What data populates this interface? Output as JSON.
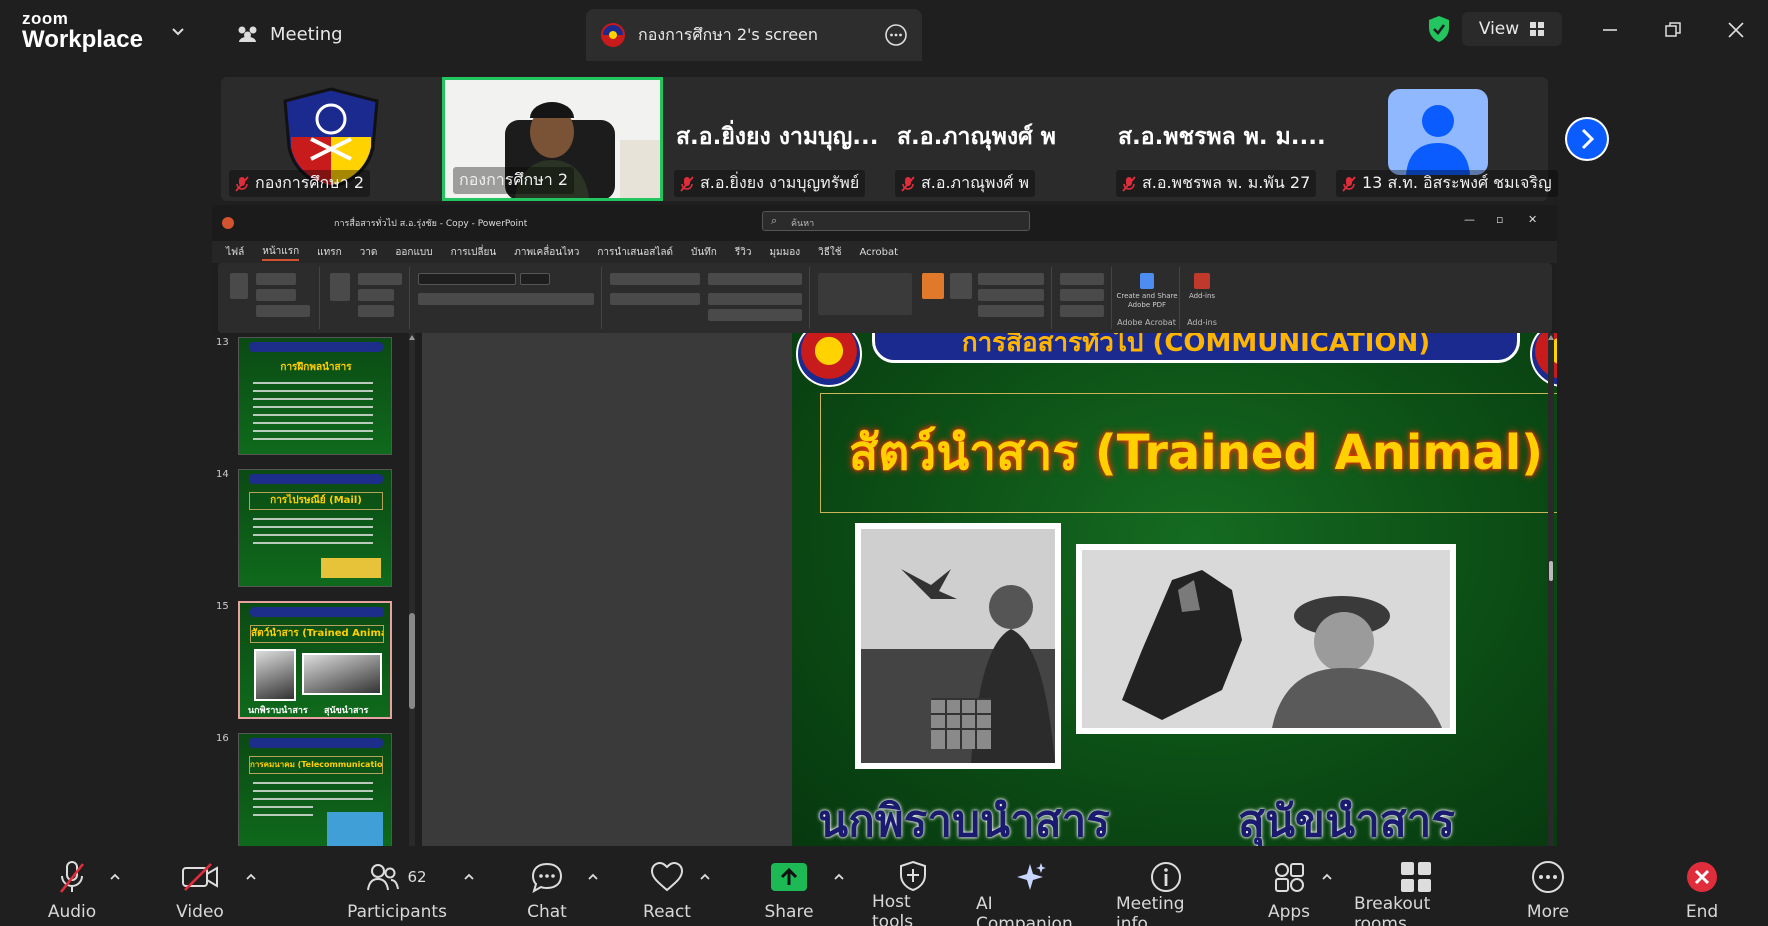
{
  "app": {
    "brand_small": "zoom",
    "brand_large": "Workplace"
  },
  "tabs": {
    "meeting": "Meeting",
    "screen": "กองการศึกษา 2's screen"
  },
  "header": {
    "view_label": "View"
  },
  "gallery": {
    "tiles": [
      {
        "name": "กองการศึกษา 2",
        "big_name": ""
      },
      {
        "name": "กองการศึกษา 2",
        "big_name": ""
      },
      {
        "name": "ส.อ.ยิ่งยง งามบุญทรัพย์",
        "big_name": "ส.อ.ยิ่งยง งามบุญ..."
      },
      {
        "name": "ส.อ.ภาณุพงศ์ พ",
        "big_name": "ส.อ.ภาณุพงศ์ พ"
      },
      {
        "name": "ส.อ.พชรพล พ. ม.พัน 27",
        "big_name": "ส.อ.พชรพล พ. ม...."
      },
      {
        "name": "13 ส.ท. อิสระพงศ์ ชมเจริญ",
        "big_name": ""
      }
    ]
  },
  "powerpoint": {
    "window_title": "การสื่อสารทั่วไป ส.อ.รุ่งชัย - Copy - PowerPoint",
    "search_placeholder": "ค้นหา",
    "menu": [
      "ไฟล์",
      "หน้าแรก",
      "แทรก",
      "วาด",
      "ออกแบบ",
      "การเปลี่ยน",
      "ภาพเคลื่อนไหว",
      "การนำเสนอสไลด์",
      "บันทึก",
      "รีวิว",
      "มุมมอง",
      "วิธีใช้",
      "Acrobat"
    ],
    "ribbon": {
      "acrobat_btn": "Create and Share Adobe PDF",
      "acrobat_group": "Adobe Acrobat",
      "addins_btn": "Add-ins",
      "addins_group": "Add-ins"
    },
    "thumbnails": [
      {
        "num": "13",
        "title": "การฝึกพลนำสาร"
      },
      {
        "num": "14",
        "title": "การไปรษณีย์ (Mail)"
      },
      {
        "num": "15",
        "title": "สัตว์นำสาร (Trained Animal)",
        "cap1": "นกพิราบนำสาร",
        "cap2": "สุนัขนำสาร"
      },
      {
        "num": "16",
        "title": "การคมนาคม (Telecommunication)"
      }
    ],
    "slide": {
      "header": "การสื่อสารทั่วไป (COMMUNICATION)",
      "title": "สัตว์นำสาร (Trained Animal)",
      "caption_left": "นกพิราบนำสาร",
      "caption_right": "สุนัขนำสาร"
    }
  },
  "toolbar": {
    "audio": "Audio",
    "video": "Video",
    "participants": "Participants",
    "participants_count": "62",
    "chat": "Chat",
    "react": "React",
    "share": "Share",
    "host_tools": "Host tools",
    "ai_companion": "AI Companion",
    "meeting_info": "Meeting info",
    "apps": "Apps",
    "breakout_rooms": "Breakout rooms",
    "more": "More",
    "end": "End"
  },
  "colors": {
    "share_green": "#1db954",
    "end_red": "#e02d3c",
    "accent_blue": "#0b5cff"
  }
}
